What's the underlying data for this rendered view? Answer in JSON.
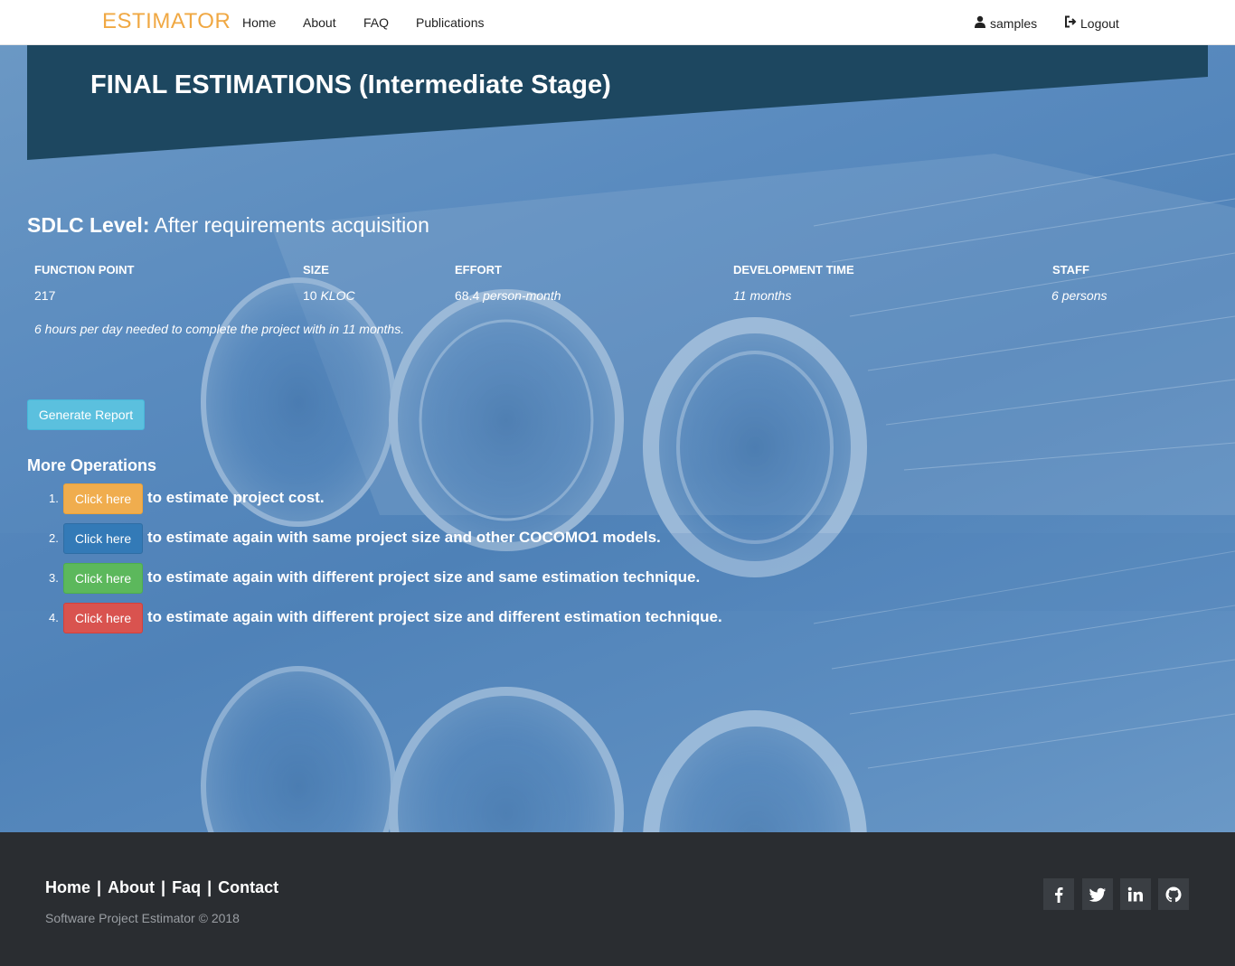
{
  "brand": {
    "name": "ESTIMATOR",
    "color": "#f0a843"
  },
  "nav": {
    "links": [
      "Home",
      "About",
      "FAQ",
      "Publications"
    ],
    "user_icon": "user-icon",
    "user_label": "samples",
    "logout_icon": "logout-icon",
    "logout_label": "Logout"
  },
  "page": {
    "title": "FINAL ESTIMATIONS (Intermediate Stage)"
  },
  "sdlc": {
    "label": "SDLC Level:",
    "value": "After requirements acquisition"
  },
  "results": {
    "headers": [
      "FUNCTION POINT",
      "SIZE",
      "EFFORT",
      "DEVELOPMENT TIME",
      "STAFF"
    ],
    "values": [
      {
        "number": "217",
        "unit": ""
      },
      {
        "number": "10",
        "unit": "KLOC"
      },
      {
        "number": "68.4",
        "unit": "person-month"
      },
      {
        "number": "11",
        "unit": "months"
      },
      {
        "number": "6",
        "unit": "persons"
      }
    ],
    "note": "6 hours per day needed to complete the project with in 11 months."
  },
  "report_button": "Generate Report",
  "operations": {
    "title": "More Operations",
    "items": [
      {
        "num": "1.",
        "button": "Click here",
        "color": "#f0ad4e",
        "text": "to estimate project cost."
      },
      {
        "num": "2.",
        "button": "Click here",
        "color": "#337ab7",
        "text": "to estimate again with same project size and other COCOMO1 models."
      },
      {
        "num": "3.",
        "button": "Click here",
        "color": "#5cb85c",
        "text": "to estimate again with different project size and same estimation technique."
      },
      {
        "num": "4.",
        "button": "Click here",
        "color": "#d9534f",
        "text": "to estimate again with different project size and different estimation technique."
      }
    ]
  },
  "footer": {
    "links": [
      "Home",
      "About",
      "Faq",
      "Contact"
    ],
    "copyright": "Software Project Estimator © 2018",
    "social": [
      "facebook-icon",
      "twitter-icon",
      "linkedin-icon",
      "github-icon"
    ]
  },
  "colors": {
    "banner": "#1d4760",
    "hero": "#5a8bbf",
    "footer": "#2a2d31"
  }
}
